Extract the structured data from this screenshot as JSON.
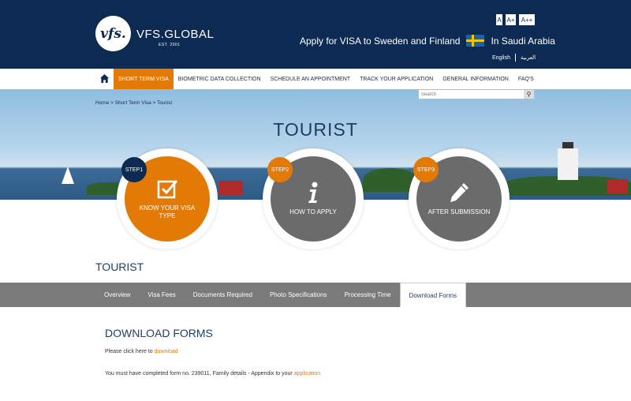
{
  "header": {
    "logo_mark": "vfs.",
    "logo_name": "VFS.GLOBAL",
    "logo_sub": "EST. 2001",
    "font_sizes": [
      "A",
      "A+",
      "A++"
    ],
    "tagline_left": "Apply for VISA to Sweden and Finland",
    "tagline_right": "In Saudi Arabia",
    "lang_english": "English",
    "lang_arabic": "العربية"
  },
  "nav": {
    "items": [
      {
        "label": "SHORT TERM VISA",
        "active": true
      },
      {
        "label": "BIOMETRIC DATA COLLECTION"
      },
      {
        "label": "SCHEDULE AN APPOINTMENT"
      },
      {
        "label": "TRACK YOUR APPLICATION"
      },
      {
        "label": "GENERAL INFORMATION"
      },
      {
        "label": "FAQ'S"
      }
    ]
  },
  "hero": {
    "breadcrumb": "Home > Short Term Visa > Tourist",
    "search_placeholder": "Search",
    "title": "TOURIST"
  },
  "steps": [
    {
      "badge": "STEP1",
      "label": "KNOW YOUR VISA TYPE",
      "icon": "checkbox-icon"
    },
    {
      "badge": "STEP2",
      "label": "HOW TO APPLY",
      "icon": "info-icon"
    },
    {
      "badge": "STEP3",
      "label": "AFTER SUBMISSION",
      "icon": "pencil-icon"
    }
  ],
  "page": {
    "title": "TOURIST"
  },
  "tabs": [
    {
      "label": "Overview"
    },
    {
      "label": "Visa Fees"
    },
    {
      "label": "Documents Required"
    },
    {
      "label": "Photo Specifications"
    },
    {
      "label": "Processing Time"
    },
    {
      "label": "Download Forms",
      "active": true
    }
  ],
  "content": {
    "section_title": "DOWNLOAD FORMS",
    "line1_text": "Please click here to ",
    "line1_link": "download",
    "line2_text": "You must have completed form no. 239011, Family details - Appendix to your ",
    "line2_link": "application"
  },
  "colors": {
    "header_bg": "#0d2b52",
    "accent": "#e37a06",
    "tab_bar": "#7a7a7a",
    "step_grey": "#6b6b6b"
  }
}
